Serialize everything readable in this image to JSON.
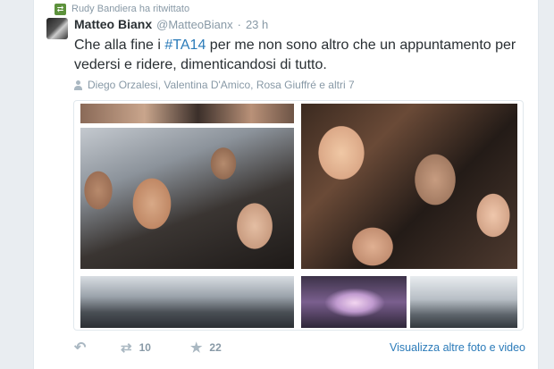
{
  "retweet_context": {
    "icon": "retweet-badge-icon",
    "text": "Rudy Bandiera ha ritwittato"
  },
  "tweet": {
    "fullname": "Matteo Bianx",
    "username": "@MatteoBianx",
    "separator": "·",
    "time": "23 h",
    "text_before": "Che alla fine i ",
    "hashtag": "#TA14",
    "text_after": " per me non sono altro che un appuntamento per vedersi e ridere, dimenticandosi di tutto.",
    "tagged": "Diego Orzalesi, Valentina D'Amico, Rosa Giuffré e altri 7"
  },
  "actions": {
    "retweet_count": "10",
    "favorite_count": "22",
    "more_photos": "Visualizza altre foto e video"
  },
  "colors": {
    "link": "#2b7bb9",
    "muted": "#8899a6",
    "text": "#292f33",
    "retweet_badge": "#5c913b"
  }
}
